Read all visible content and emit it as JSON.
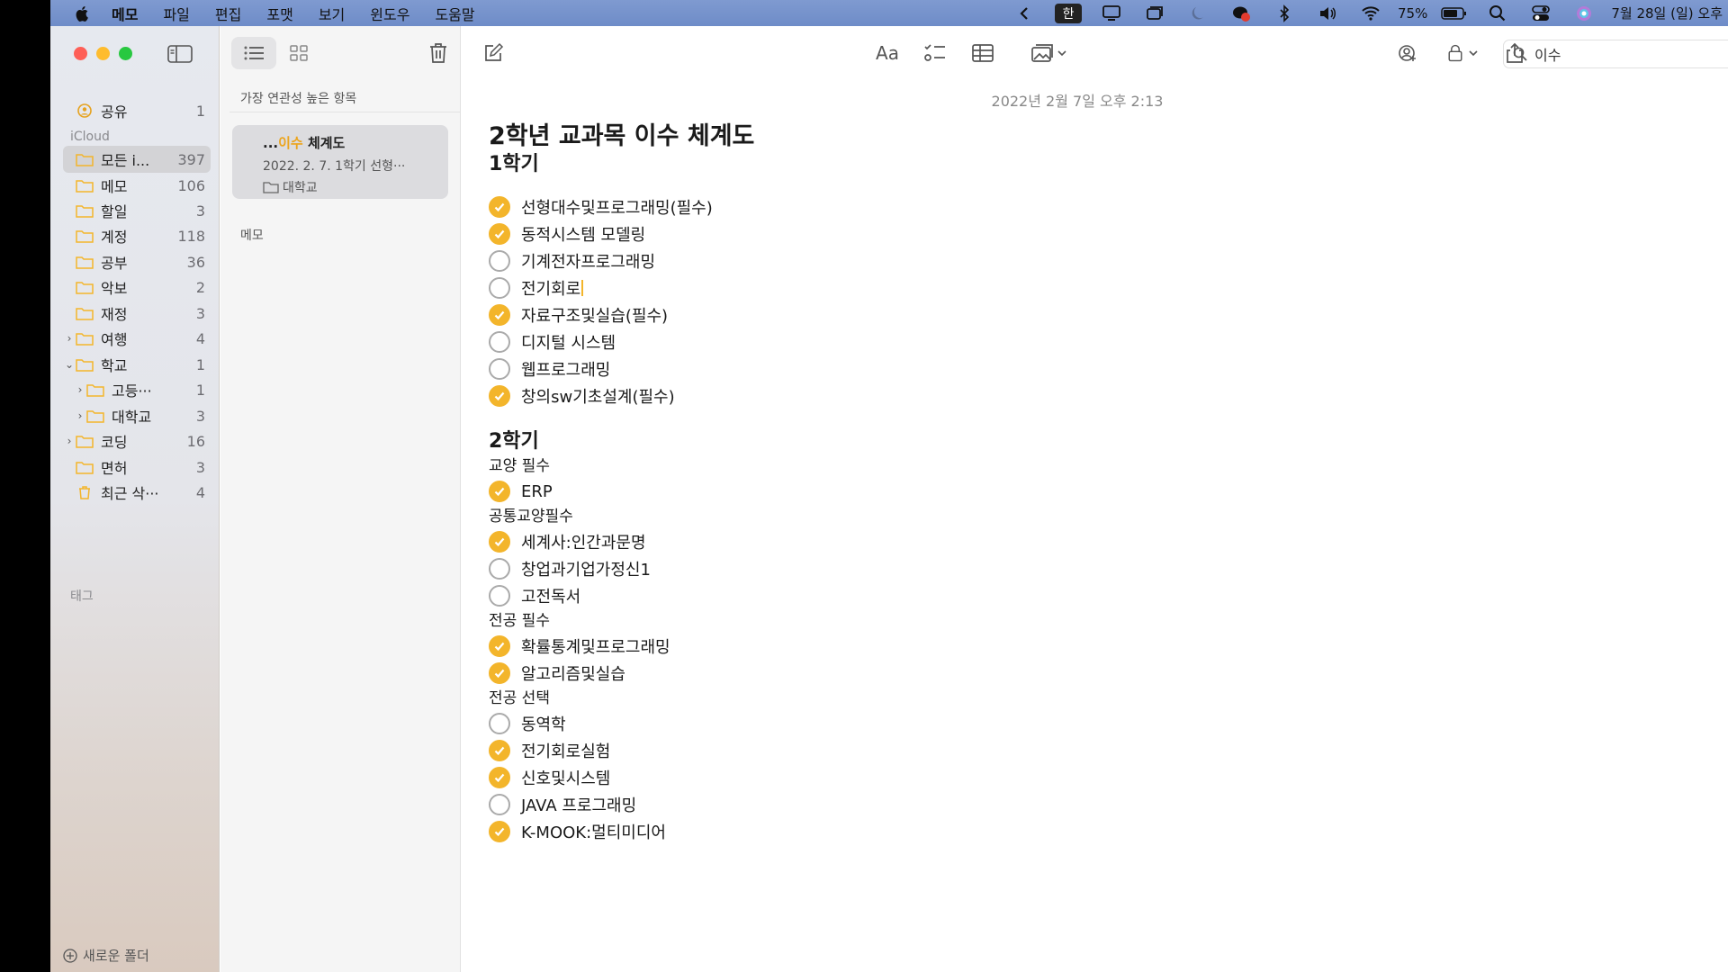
{
  "menubar": {
    "app_name": "메모",
    "items": [
      "파일",
      "편집",
      "포맷",
      "보기",
      "윈도우",
      "도움말"
    ],
    "input_method": "한",
    "battery": "75%",
    "datetime": "7월 28일 (일) 오후"
  },
  "sidebar": {
    "shared": {
      "label": "공유",
      "count": "1"
    },
    "section_icloud": "iCloud",
    "folders": [
      {
        "label": "모든 i...",
        "count": "397",
        "selected": true
      },
      {
        "label": "메모",
        "count": "106"
      },
      {
        "label": "할일",
        "count": "3"
      },
      {
        "label": "계정",
        "count": "118"
      },
      {
        "label": "공부",
        "count": "36"
      },
      {
        "label": "악보",
        "count": "2"
      },
      {
        "label": "재정",
        "count": "3"
      },
      {
        "label": "여행",
        "count": "4"
      },
      {
        "label": "학교",
        "count": "1"
      },
      {
        "label": "고등···",
        "count": "1"
      },
      {
        "label": "대학교",
        "count": "3"
      },
      {
        "label": "코딩",
        "count": "16"
      },
      {
        "label": "면허",
        "count": "3"
      },
      {
        "label": "최근 삭···",
        "count": "4"
      }
    ],
    "section_tags": "태그",
    "new_folder": "새로운 폴더"
  },
  "notelist": {
    "header": "가장 연관성 높은 항목",
    "card": {
      "title_prefix": "...",
      "title_highlight": "이수",
      "title_suffix": " 체계도",
      "meta": "2022. 2. 7.  1학기 선형···",
      "folder": "대학교"
    },
    "section2": "메모"
  },
  "editor": {
    "search_value": "이수",
    "date": "2022년 2월 7일 오후 2:13",
    "title": "2학년 교과목 이수 체계도",
    "sem1": "1학기",
    "sem1_items": [
      {
        "text": "선형대수및프로그래밍(필수)",
        "checked": true
      },
      {
        "text": "동적시스템 모델링",
        "checked": true
      },
      {
        "text": "기계전자프로그래밍",
        "checked": false
      },
      {
        "text": "전기회로",
        "checked": false
      },
      {
        "text": "자료구조및실습(필수)",
        "checked": true
      },
      {
        "text": "디지털 시스템",
        "checked": false
      },
      {
        "text": "웹프로그래밍",
        "checked": false
      },
      {
        "text": "창의sw기초설계(필수)",
        "checked": true
      }
    ],
    "sem2": "2학기",
    "groups": [
      {
        "label": "교양 필수",
        "items": [
          {
            "text": "ERP",
            "checked": true
          }
        ]
      },
      {
        "label": "공통교양필수",
        "items": [
          {
            "text": "세계사:인간과문명",
            "checked": true
          },
          {
            "text": "창업과기업가정신1",
            "checked": false
          },
          {
            "text": "고전독서",
            "checked": false
          }
        ]
      },
      {
        "label": "전공 필수",
        "items": [
          {
            "text": "확률통계및프로그래밍",
            "checked": true
          },
          {
            "text": "알고리즘및실습",
            "checked": true
          }
        ]
      },
      {
        "label": "전공 선택",
        "items": [
          {
            "text": "동역학",
            "checked": false
          },
          {
            "text": "전기회로실험",
            "checked": true
          },
          {
            "text": "신호및시스템",
            "checked": true
          },
          {
            "text": "JAVA 프로그래밍",
            "checked": false
          },
          {
            "text": "K-MOOK:멀티미디어",
            "checked": true
          }
        ]
      }
    ]
  },
  "colors": {
    "accent": "#f3b52b",
    "menubar": "#7592cb",
    "sidebar_selected": "#d3d3d6"
  }
}
